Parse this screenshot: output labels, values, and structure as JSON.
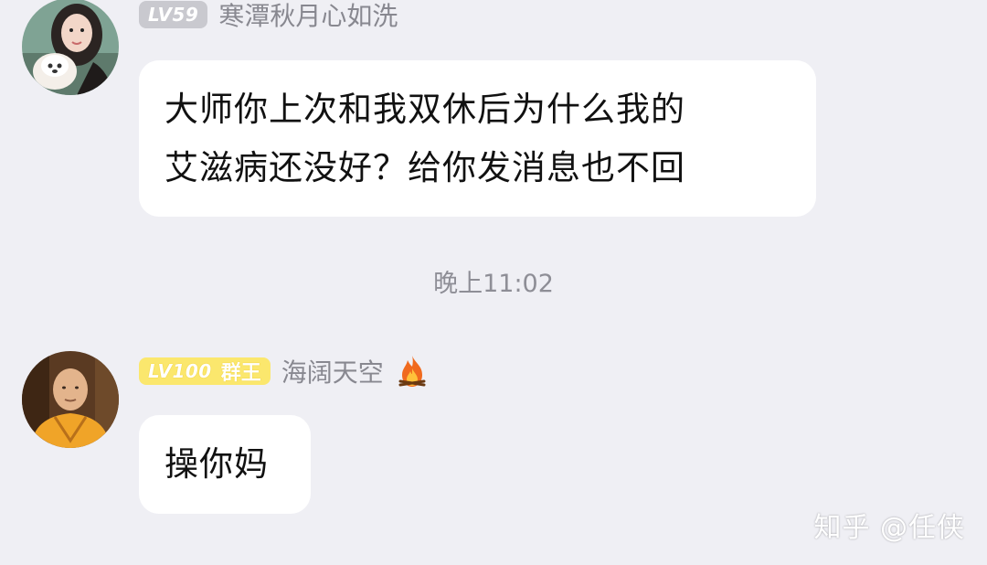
{
  "messages": [
    {
      "level": "LV59",
      "nickname": "寒潭秋月心如洗",
      "lines": [
        "大师你上次和我双休后为什么我的",
        "艾滋病还没好？给你发消息也不回"
      ]
    },
    {
      "level": "LV100",
      "role": "群王",
      "nickname": "海阔天空",
      "lines": [
        "操你妈"
      ]
    }
  ],
  "time_divider": "晚上11:02",
  "watermark": "知乎 @任侠",
  "icons": {
    "fire": "fire-icon",
    "avatar1": "avatar",
    "avatar2": "avatar"
  },
  "colors": {
    "background": "#efeff4",
    "bubble": "#ffffff",
    "level_gray": "#c9c9cf",
    "level_gold": "#fbe76d",
    "nickname": "#888890"
  }
}
